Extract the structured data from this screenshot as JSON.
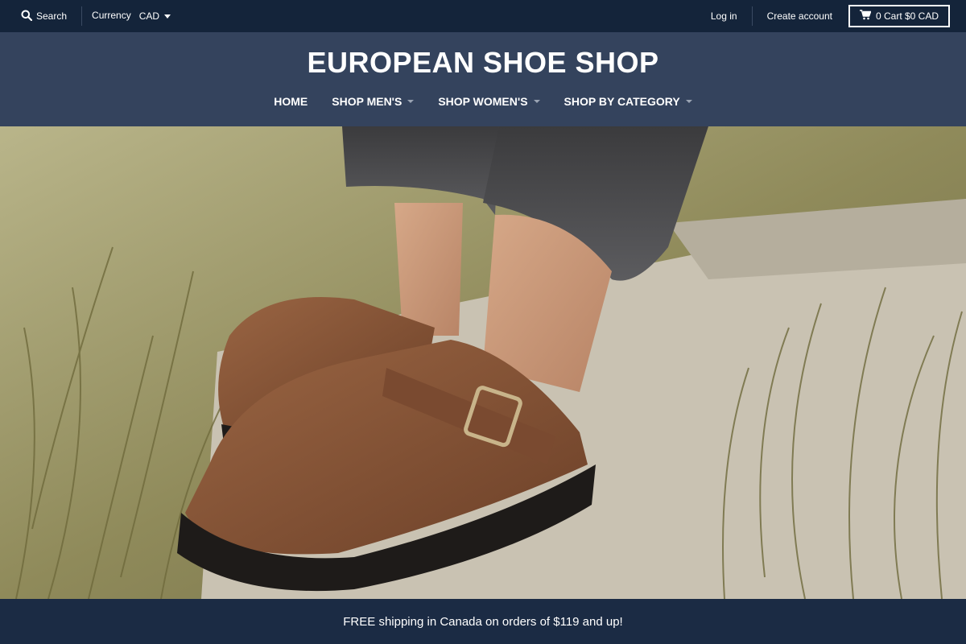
{
  "topbar": {
    "search_label": "Search",
    "currency_label": "Currency",
    "currency_value": "CAD",
    "login_label": "Log in",
    "create_account_label": "Create account",
    "cart_label": "0 Cart $0 CAD"
  },
  "header": {
    "logo_text": "EUROPEAN SHOE SHOP"
  },
  "nav": {
    "items": [
      {
        "label": "HOME"
      },
      {
        "label": "SHOP MEN'S"
      },
      {
        "label": "SHOP WOMEN'S"
      },
      {
        "label": "SHOP BY CATEGORY"
      }
    ]
  },
  "banner": {
    "text": "FREE shipping in Canada on orders of $119 and up!"
  },
  "colors": {
    "topbar_bg": "#14243a",
    "header_bg": "#34435d",
    "banner_bg": "#1b2b44"
  }
}
